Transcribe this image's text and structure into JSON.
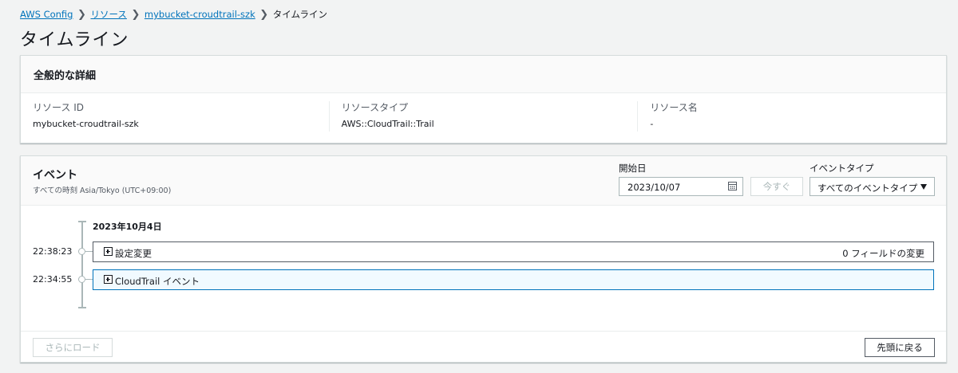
{
  "breadcrumb": {
    "items": [
      "AWS Config",
      "リソース",
      "mybucket-croudtrail-szk"
    ],
    "current": "タイムライン"
  },
  "page": {
    "title": "タイムライン"
  },
  "details": {
    "title": "全般的な詳細",
    "fields": [
      {
        "label": "リソース ID",
        "value": "mybucket-croudtrail-szk"
      },
      {
        "label": "リソースタイプ",
        "value": "AWS::CloudTrail::Trail"
      },
      {
        "label": "リソース名",
        "value": "-"
      }
    ]
  },
  "events": {
    "title": "イベント",
    "timezone": "すべての時刻 Asia/Tokyo (UTC+09:00)",
    "start_date_label": "開始日",
    "start_date_value": "2023/10/07",
    "now_label": "今すぐ",
    "event_type_label": "イベントタイプ",
    "event_type_value": "すべてのイベントタイプ",
    "date_group": "2023年10月4日",
    "items": [
      {
        "time": "22:38:23",
        "label": "設定変更",
        "count": "0 フィールドの変更"
      },
      {
        "time": "22:34:55",
        "label": "CloudTrail イベント",
        "count": ""
      }
    ],
    "load_more_label": "さらにロード",
    "back_to_top_label": "先頭に戻る"
  },
  "colors": {
    "link": "#0073bb",
    "selected_border": "#0073bb",
    "background": "#f2f3f3"
  }
}
